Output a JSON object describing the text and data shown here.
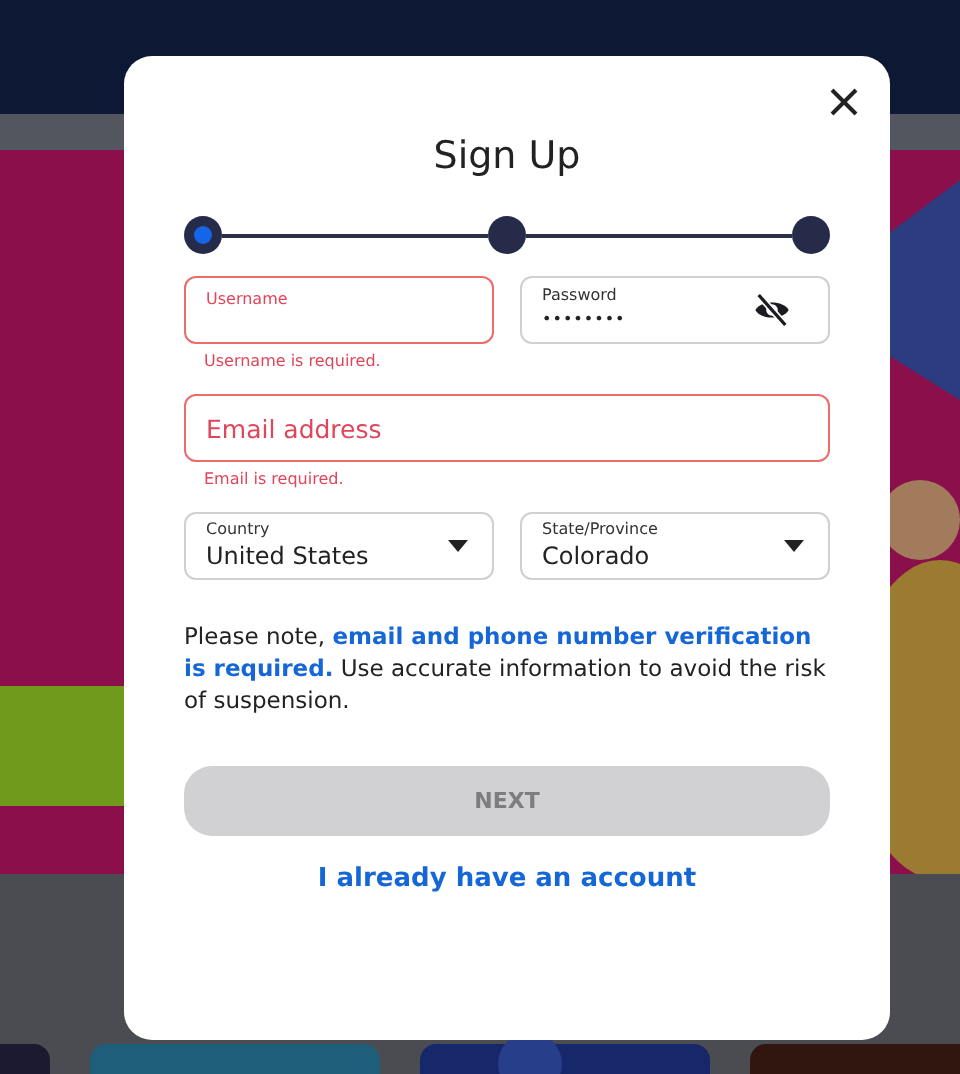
{
  "dialog": {
    "title": "Sign Up",
    "steps": [
      {
        "selected": true
      },
      {
        "selected": false
      },
      {
        "selected": false
      }
    ],
    "rows": [
      [
        {
          "kind": "text",
          "label": "Username",
          "invalid": true,
          "error": "Username is required."
        },
        {
          "kind": "password",
          "label": "Password",
          "value": "••••••••",
          "invalid": false
        }
      ],
      [
        {
          "kind": "text",
          "placeholder": "Email address",
          "invalid": true,
          "error": "Email is required."
        }
      ],
      [
        {
          "kind": "select",
          "label": "Country",
          "value": "United States",
          "invalid": false
        },
        {
          "kind": "select",
          "label": "State/Province",
          "value": "Colorado",
          "invalid": false
        }
      ]
    ],
    "note": "Please note, **email and phone number verification is required.** Use accurate information to avoid the risk of suspension.",
    "next_button": {
      "label": "NEXT",
      "disabled": true
    },
    "login_link": "I already have an account"
  }
}
